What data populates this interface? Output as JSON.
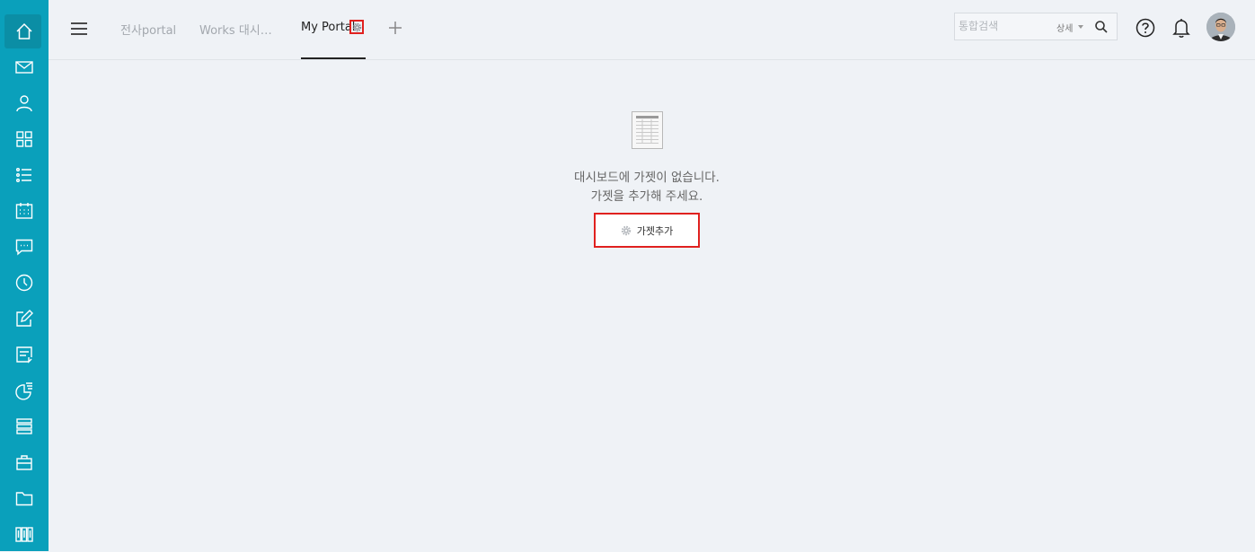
{
  "sidebar": {
    "items": [
      {
        "name": "home-icon",
        "active": true
      },
      {
        "name": "mail-icon"
      },
      {
        "name": "contacts-icon"
      },
      {
        "name": "apps-icon"
      },
      {
        "name": "list-icon"
      },
      {
        "name": "calendar-icon"
      },
      {
        "name": "chat-icon"
      },
      {
        "name": "clock-icon"
      },
      {
        "name": "edit-icon"
      },
      {
        "name": "board-icon"
      },
      {
        "name": "report-icon"
      },
      {
        "name": "database-icon"
      },
      {
        "name": "briefcase-icon"
      },
      {
        "name": "folder-icon"
      },
      {
        "name": "library-icon"
      }
    ]
  },
  "header": {
    "tabs": [
      {
        "label": "전사portal"
      },
      {
        "label": "Works 대시…"
      },
      {
        "label": "My Portal",
        "active": true
      }
    ],
    "search": {
      "placeholder": "통합검색",
      "detail_label": "상세"
    }
  },
  "main": {
    "empty_message_line1": "대시보드에 가젯이 없습니다.",
    "empty_message_line2": "가젯을 추가해 주세요.",
    "add_gadget_label": "가젯추가"
  },
  "colors": {
    "sidebar": "#0aa0bb",
    "background": "#eff2f6",
    "highlight": "#e0211f"
  }
}
